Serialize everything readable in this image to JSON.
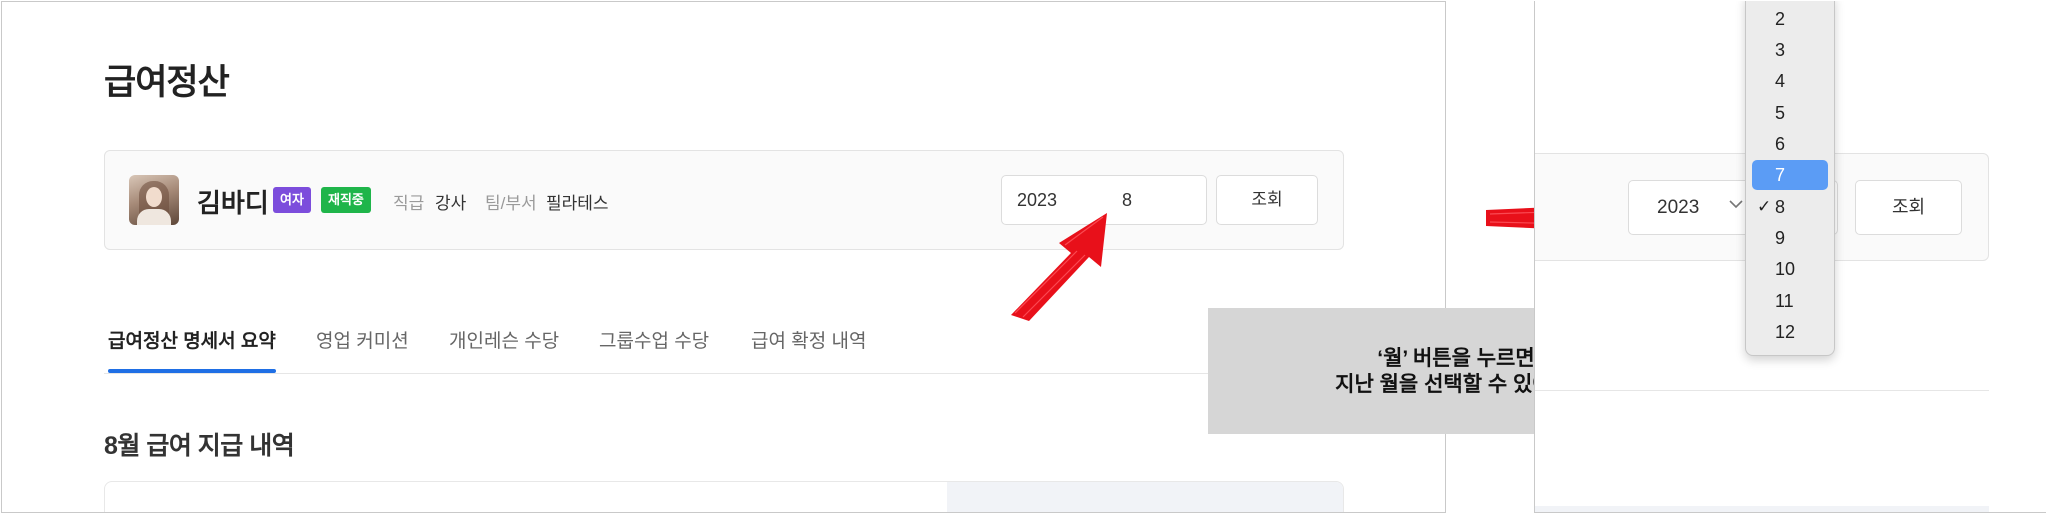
{
  "left_panel": {
    "title": "급여정산",
    "profile": {
      "name": "김바디",
      "gender_badge": "여자",
      "status_badge": "재직중",
      "position_label": "직급",
      "position_value": "강사",
      "team_label": "팀/부서",
      "team_value": "필라테스"
    },
    "period": {
      "year": "2023",
      "month": "8"
    },
    "search_label": "조회",
    "tabs": [
      "급여정산 명세서 요약",
      "영업 커미션",
      "개인레슨 수당",
      "그룹수업 수당",
      "급여 확정 내역"
    ],
    "active_tab": "급여정산 명세서 요약",
    "section_title": "8월 급여 지급 내역"
  },
  "callout": {
    "text": "‘월’ 버튼을 누르면\n지난 월을 선택할 수 있어요."
  },
  "right_panel": {
    "year_select": {
      "value": "2023"
    },
    "search_label": "조회",
    "month_options": [
      "2",
      "3",
      "4",
      "5",
      "6",
      "7",
      "8",
      "9",
      "10",
      "11",
      "12"
    ],
    "highlighted_option": "7",
    "checked_option": "8"
  },
  "colors": {
    "accent_tab": "#1f6fe5",
    "gender_badge": "#7c4ddc",
    "status_badge": "#1fb54a",
    "arrow": "#e8101a",
    "dropdown_highlight": "#5b9cf5",
    "callout_bg": "#d6d6d6"
  },
  "icons": {
    "year_chevron": "chevron-down-icon",
    "checkmark": "checkmark-icon"
  }
}
